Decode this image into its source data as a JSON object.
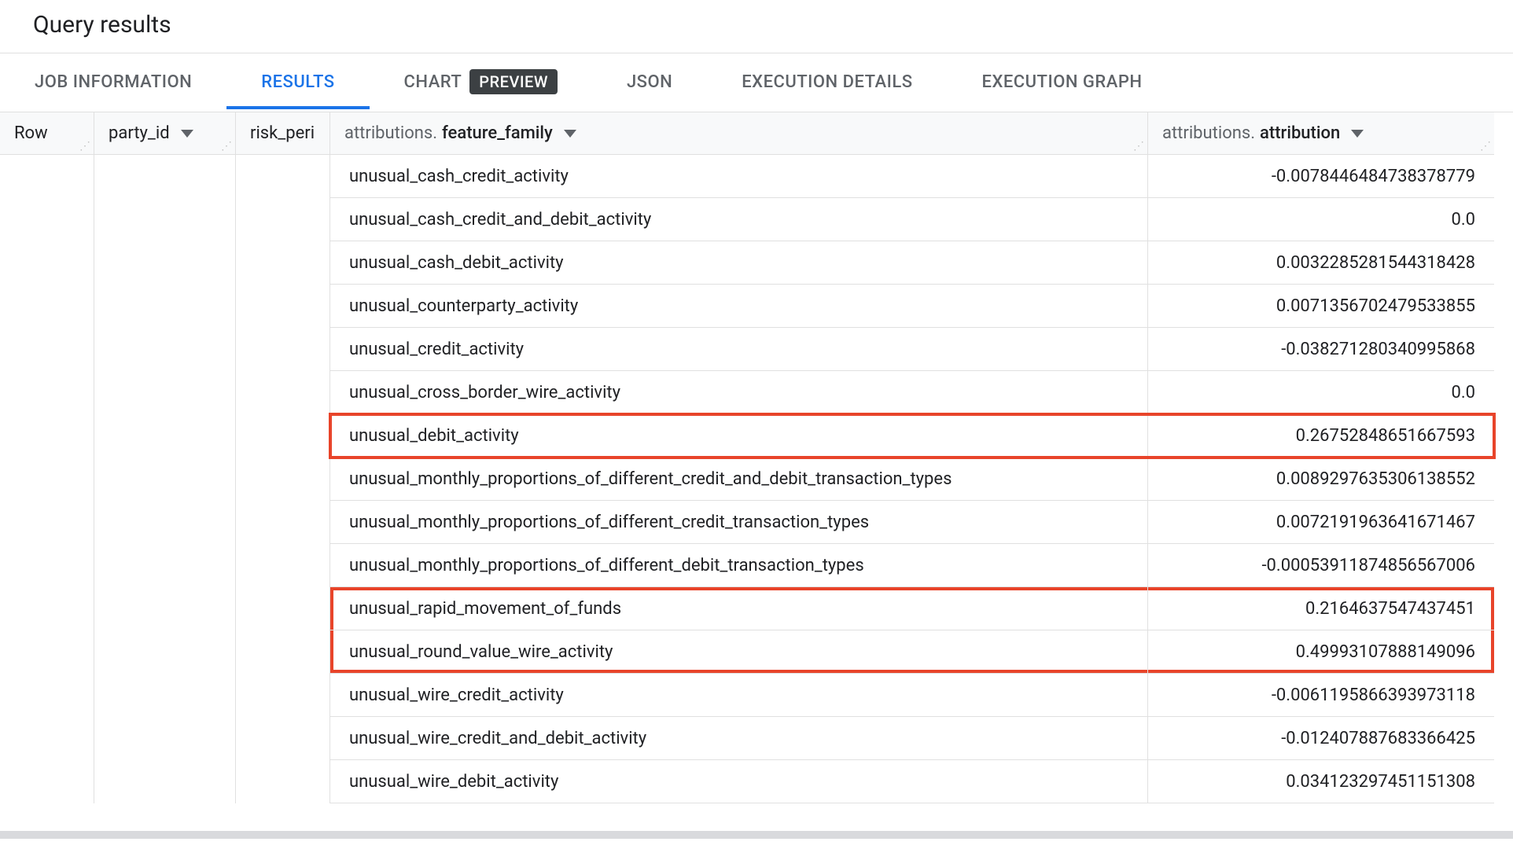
{
  "title": "Query results",
  "tabs": {
    "job_information": "JOB INFORMATION",
    "results": "RESULTS",
    "chart": "CHART",
    "chart_badge": "PREVIEW",
    "json": "JSON",
    "execution_details": "EXECUTION DETAILS",
    "execution_graph": "EXECUTION GRAPH"
  },
  "columns": {
    "row": "Row",
    "party_id": "party_id",
    "risk_peri": "risk_peri",
    "feature_family_prefix": "attributions.",
    "feature_family_bold": "feature_family",
    "attribution_prefix": "attributions.",
    "attribution_bold": "attribution"
  },
  "rows": [
    {
      "feature": "unusual_cash_credit_activity",
      "attr": "-0.0078446484738378779",
      "hl": false
    },
    {
      "feature": "unusual_cash_credit_and_debit_activity",
      "attr": "0.0",
      "hl": false
    },
    {
      "feature": "unusual_cash_debit_activity",
      "attr": "0.0032285281544318428",
      "hl": false
    },
    {
      "feature": "unusual_counterparty_activity",
      "attr": "0.0071356702479533855",
      "hl": false
    },
    {
      "feature": "unusual_credit_activity",
      "attr": "-0.038271280340995868",
      "hl": false
    },
    {
      "feature": "unusual_cross_border_wire_activity",
      "attr": "0.0",
      "hl": false
    },
    {
      "feature": "unusual_debit_activity",
      "attr": "0.26752848651667593",
      "hl": true,
      "group": 1
    },
    {
      "feature": "unusual_monthly_proportions_of_different_credit_and_debit_transaction_types",
      "attr": "0.0089297635306138552",
      "hl": false
    },
    {
      "feature": "unusual_monthly_proportions_of_different_credit_transaction_types",
      "attr": "0.0072191963641671467",
      "hl": false
    },
    {
      "feature": "unusual_monthly_proportions_of_different_debit_transaction_types",
      "attr": "-0.00053911874856567006",
      "hl": false
    },
    {
      "feature": "unusual_rapid_movement_of_funds",
      "attr": "0.2164637547437451",
      "hl": true,
      "group": 2
    },
    {
      "feature": "unusual_round_value_wire_activity",
      "attr": "0.49993107888149096",
      "hl": true,
      "group": 2
    },
    {
      "feature": "unusual_wire_credit_activity",
      "attr": "-0.0061195866393973118",
      "hl": false
    },
    {
      "feature": "unusual_wire_credit_and_debit_activity",
      "attr": "-0.012407887683366425",
      "hl": false
    },
    {
      "feature": "unusual_wire_debit_activity",
      "attr": "0.034123297451151308",
      "hl": false
    }
  ]
}
